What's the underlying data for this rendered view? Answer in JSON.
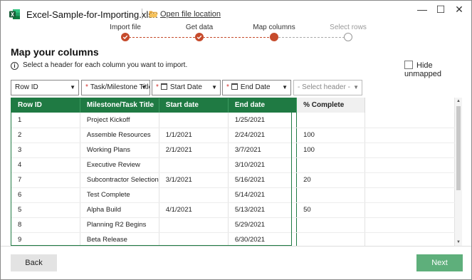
{
  "window": {
    "file_title": "Excel-Sample-for-Importing.xlsx",
    "open_location_label": "Open file location",
    "minimize_glyph": "—",
    "maximize_glyph": "☐",
    "close_glyph": "✕"
  },
  "steps": [
    {
      "label": "Import file",
      "state": "done"
    },
    {
      "label": "Get data",
      "state": "done"
    },
    {
      "label": "Map columns",
      "state": "current"
    },
    {
      "label": "Select rows",
      "state": "pending"
    }
  ],
  "page": {
    "heading": "Map your columns",
    "info_text": "Select a header for each column you want to import.",
    "hide_unmapped_label": "Hide unmapped"
  },
  "header_selects": [
    {
      "label": "Row ID",
      "required": false,
      "icon": null
    },
    {
      "label": "Task/Milestone Title",
      "required": true,
      "icon": null
    },
    {
      "label": "Start Date",
      "required": true,
      "icon": "calendar-icon"
    },
    {
      "label": "End Date",
      "required": true,
      "icon": "calendar-icon"
    },
    {
      "label": "- Select header -",
      "required": false,
      "icon": null
    }
  ],
  "table": {
    "columns": [
      "Row ID",
      "Milestone/Task Title",
      "Start date",
      "End date",
      "% Complete",
      ""
    ],
    "rows": [
      [
        "1",
        "Project Kickoff",
        "",
        "1/25/2021",
        "",
        ""
      ],
      [
        "2",
        "Assemble Resources",
        "1/1/2021",
        "2/24/2021",
        "100",
        ""
      ],
      [
        "3",
        "Working Plans",
        "2/1/2021",
        "3/7/2021",
        "100",
        ""
      ],
      [
        "4",
        "Executive Review",
        "",
        "3/10/2021",
        "",
        ""
      ],
      [
        "7",
        "Subcontractor Selection",
        "3/1/2021",
        "5/16/2021",
        "20",
        ""
      ],
      [
        "6",
        "Test Complete",
        "",
        "5/14/2021",
        "",
        ""
      ],
      [
        "5",
        "Alpha Build",
        "4/1/2021",
        "5/13/2021",
        "50",
        ""
      ],
      [
        "8",
        "Planning R2 Begins",
        "",
        "5/29/2021",
        "",
        ""
      ],
      [
        "9",
        "Beta Release",
        "",
        "6/30/2021",
        "",
        ""
      ],
      [
        "",
        "",
        "",
        "",
        "",
        ""
      ]
    ]
  },
  "footer": {
    "back_label": "Back",
    "next_label": "Next"
  },
  "colors": {
    "accent_green": "#1f7a43",
    "next_button": "#5eaf7b",
    "step_active": "#c64b2c"
  }
}
